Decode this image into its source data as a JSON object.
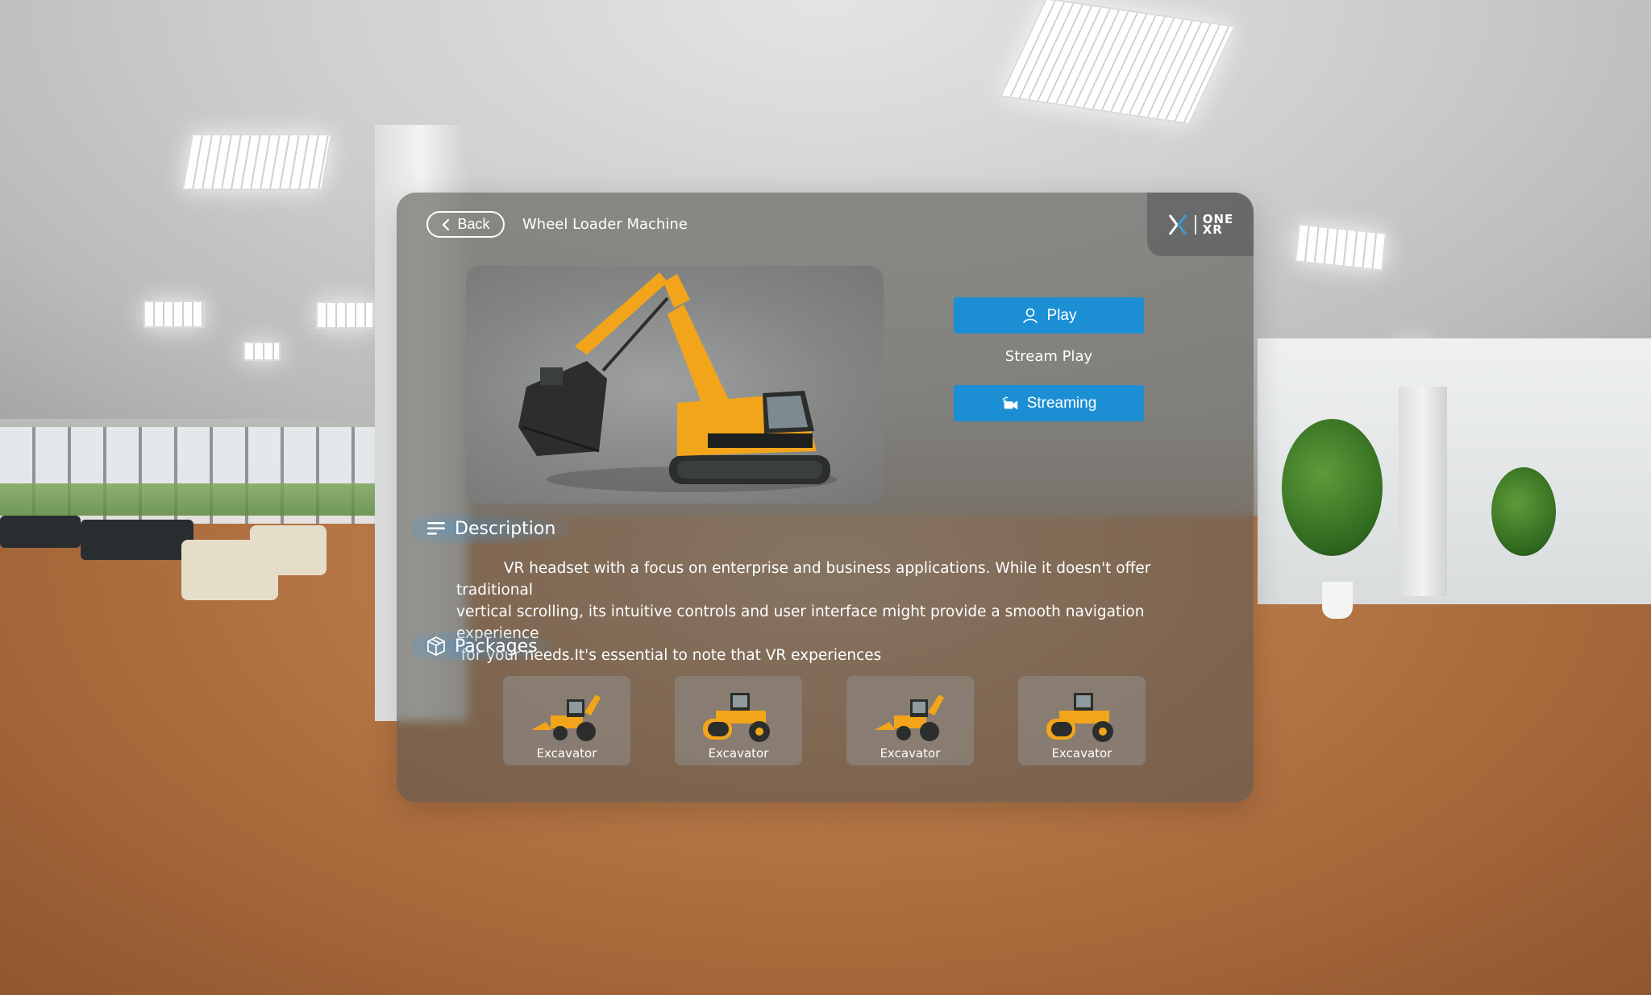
{
  "header": {
    "back_label": "Back",
    "title": "Wheel Loader Machine",
    "logo_text_line1": "ONE",
    "logo_text_line2": "XR"
  },
  "actions": {
    "play_label": "Play",
    "stream_play_label": "Stream Play",
    "streaming_label": "Streaming"
  },
  "description": {
    "heading": "Description",
    "text": "          VR headset with a focus on enterprise and business applications. While it doesn't offer traditional\nvertical scrolling, its intuitive controls and user interface might provide a smooth navigation experience\n for your needs.It's essential to note that VR experiences"
  },
  "packages": {
    "heading": "Packages",
    "items": [
      {
        "label": "Excavator",
        "icon": "backhoe-loader-icon"
      },
      {
        "label": "Excavator",
        "icon": "road-roller-icon"
      },
      {
        "label": "Excavator",
        "icon": "backhoe-loader-icon"
      },
      {
        "label": "Excavator",
        "icon": "road-roller-icon"
      }
    ]
  },
  "colors": {
    "accent": "#1c8fd4",
    "panel": "#5c5854",
    "machine_yellow": "#f2a51a"
  }
}
